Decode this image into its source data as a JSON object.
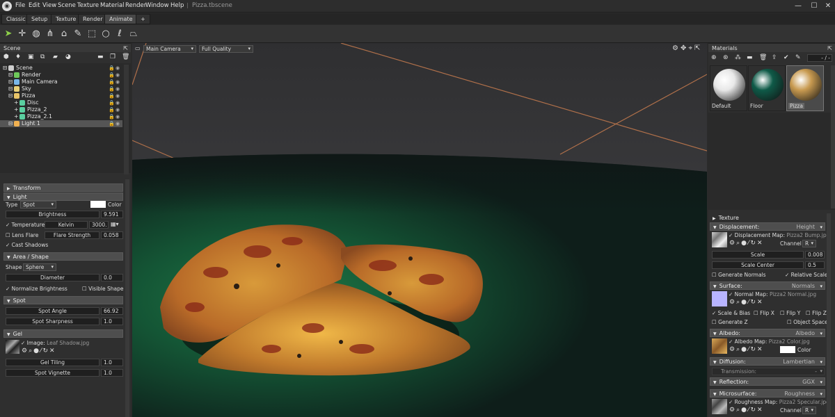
{
  "app": {
    "menus": [
      "File",
      "Edit",
      "View",
      "Scene",
      "Texture",
      "Material",
      "Render",
      "Window",
      "Help"
    ],
    "doc_title": "Pizza.tbscene",
    "window_controls": [
      "minimize-icon",
      "maximize-icon",
      "close-icon"
    ]
  },
  "tabs": [
    "Classic",
    "Setup",
    "Texture",
    "Render",
    "Animate",
    "+"
  ],
  "tools": [
    "select-arrow-icon",
    "move-gizmo-icon",
    "rotate-globe-icon",
    "hierarchy-icon",
    "ignite-icon",
    "paint-icon",
    "marquee-rect-icon",
    "marquee-circle-icon",
    "lasso-icon",
    "polygon-lasso-icon"
  ],
  "scene": {
    "title": "Scene",
    "tree": [
      {
        "label": "Scene",
        "indent": 0,
        "color": "#cfcfcf"
      },
      {
        "label": "Render",
        "indent": 1,
        "color": "#6ec85a"
      },
      {
        "label": "Main Camera",
        "indent": 1,
        "color": "#78b6e8"
      },
      {
        "label": "Sky",
        "indent": 1,
        "color": "#e8d078"
      },
      {
        "label": "Pizza",
        "indent": 1,
        "color": "#e8c468"
      },
      {
        "label": "Disc",
        "indent": 2,
        "color": "#5ad0a0"
      },
      {
        "label": "Pizza_2",
        "indent": 2,
        "color": "#5ad0a0"
      },
      {
        "label": "Pizza_2.1",
        "indent": 2,
        "color": "#5ad0a0"
      },
      {
        "label": "Light 1",
        "indent": 1,
        "color": "#f0b050",
        "selected": true
      }
    ]
  },
  "props": {
    "transform": "Transform",
    "light": {
      "title": "Light",
      "type_label": "Type",
      "type_value": "Spot",
      "color_label": "Color",
      "brightness_label": "Brightness",
      "brightness": "9.591",
      "temperature_label": "Temperature",
      "kelvin_label": "Kelvin",
      "kelvin": "3000.",
      "lens_flare": "Lens Flare",
      "flare_strength_label": "Flare Strength",
      "flare_strength": "0.058",
      "cast_shadows": "Cast Shadows"
    },
    "area": {
      "title": "Area / Shape",
      "shape_label": "Shape",
      "shape_value": "Sphere",
      "diameter_label": "Diameter",
      "diameter": "0.0",
      "normalize": "Normalize Brightness",
      "visible": "Visible Shape"
    },
    "spot": {
      "title": "Spot",
      "angle_label": "Spot Angle",
      "angle": "66.92",
      "sharp_label": "Spot Sharpness",
      "sharp": "1.0"
    },
    "gel": {
      "title": "Gel",
      "image_label": "Image:",
      "image_file": "Leaf Shadow.jpg",
      "tiling_label": "Gel Tiling",
      "tiling": "1.0",
      "vignette_label": "Spot Vignette",
      "vignette": "1.0"
    }
  },
  "viewport": {
    "camera": "Main Camera",
    "quality": "Full Quality"
  },
  "materials": {
    "title": "Materials",
    "page": "- / -",
    "items": [
      {
        "name": "Default",
        "color": "#e8e8e8"
      },
      {
        "name": "Floor",
        "color": "#0f5a48"
      },
      {
        "name": "Pizza",
        "color": "#c89a50",
        "selected": true
      }
    ],
    "texture": "Texture",
    "displacement": {
      "title": "Displacement:",
      "mode": "Height",
      "map_label": "Displacement Map:",
      "map_file": "Pizza2 Bump.jpg",
      "channel_label": "Channel",
      "channel": "R",
      "scale_label": "Scale",
      "scale": "0.008",
      "center_label": "Scale Center",
      "center": "0.5",
      "gen_normals": "Generate Normals",
      "relative": "Relative Scale"
    },
    "surface": {
      "title": "Surface:",
      "mode": "Normals",
      "map_label": "Normal Map:",
      "map_file": "Pizza2 Normal.jpg",
      "scale_bias": "Scale & Bias",
      "flipx": "Flip X",
      "flipy": "Flip Y",
      "flipz": "Flip Z",
      "genz": "Generate Z",
      "object_space": "Object Space"
    },
    "albedo": {
      "title": "Albedo:",
      "mode": "Albedo",
      "map_label": "Albedo Map:",
      "map_file": "Pizza2 Color.jpg",
      "color_label": "Color"
    },
    "diffusion": {
      "title": "Diffusion:",
      "mode": "Lambertian",
      "transmission": "Transmission:",
      "trans_value": "-"
    },
    "reflection": {
      "title": "Reflection:",
      "mode": "GGX"
    },
    "microsurface": {
      "title": "Microsurface:",
      "mode": "Roughness",
      "map_label": "Roughness Map:",
      "map_file": "Pizza2 Specular.jpg",
      "channel_label": "Channel",
      "channel": "R"
    }
  }
}
